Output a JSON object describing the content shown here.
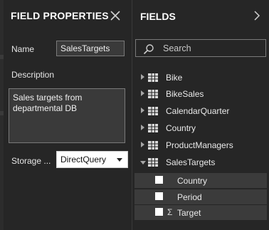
{
  "field_properties": {
    "title": "FIELD PROPERTIES",
    "close_icon": "close-icon",
    "name_label": "Name",
    "name_value": "SalesTargets",
    "description_label": "Description",
    "description_value": "Sales targets from departmental DB",
    "storage_label": "Storage ...",
    "storage_value": "DirectQuery"
  },
  "fields": {
    "title": "FIELDS",
    "search_placeholder": "Search",
    "tables": [
      {
        "label": "Bike",
        "expanded": false
      },
      {
        "label": "BikeSales",
        "expanded": false
      },
      {
        "label": "CalendarQuarter",
        "expanded": false
      },
      {
        "label": "Country",
        "expanded": false
      },
      {
        "label": "ProductManagers",
        "expanded": false
      },
      {
        "label": "SalesTargets",
        "expanded": true
      }
    ],
    "sales_targets_fields": [
      {
        "label": "Country",
        "sigma": ""
      },
      {
        "label": "Period",
        "sigma": ""
      },
      {
        "label": "Target",
        "sigma": "Σ"
      }
    ]
  },
  "colors": {
    "panel_bg": "#262626",
    "input_bg": "#3a3a3a",
    "field_row_bg": "#3b3b3b",
    "text": "#eaeaea"
  }
}
